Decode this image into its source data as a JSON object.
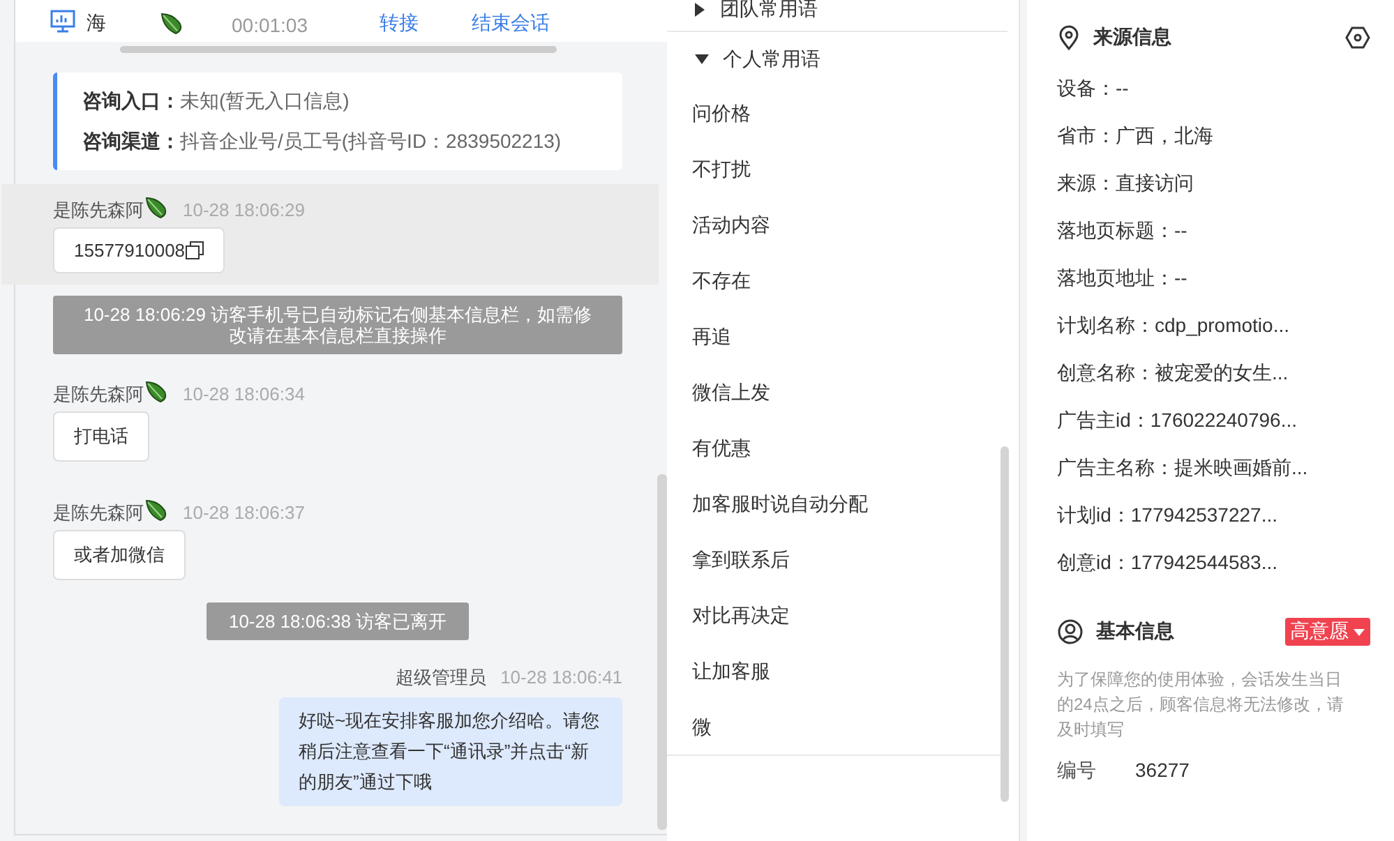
{
  "header": {
    "location": "海",
    "duration": "00:01:03",
    "actions": [
      {
        "label": "转接"
      },
      {
        "label": "结束会话"
      }
    ]
  },
  "consult_info": [
    {
      "label": "咨询入口：",
      "value": "未知(暂无入口信息)"
    },
    {
      "label": "咨询渠道：",
      "value": "抖音企业号/员工号(抖音号ID：2839502213)"
    }
  ],
  "messages": [
    {
      "kind": "visitor",
      "sender": "是陈先森阿",
      "time": "10-28 18:06:29",
      "text": "15577910008",
      "highlighted": true,
      "copyable": true
    },
    {
      "kind": "system",
      "text": "10-28 18:06:29 访客手机号已自动标记右侧基本信息栏，如需修改请在基本信息栏直接操作"
    },
    {
      "kind": "visitor",
      "sender": "是陈先森阿",
      "time": "10-28 18:06:34",
      "text": "打电话",
      "highlighted": false,
      "copyable": false
    },
    {
      "kind": "visitor",
      "sender": "是陈先森阿",
      "time": "10-28 18:06:37",
      "text": "或者加微信",
      "highlighted": false,
      "copyable": false
    },
    {
      "kind": "system",
      "text": "10-28 18:06:38 访客已离开"
    },
    {
      "kind": "agent",
      "sender": "超级管理员",
      "time": "10-28 18:06:41",
      "text": "好哒~现在安排客服加您介绍哈。请您稍后注意查看一下“通讯录”并点击“新的朋友”通过下哦",
      "highlighted": false,
      "copyable": false
    }
  ],
  "phrases": [
    {
      "title": "团队常用语",
      "expanded": false
    },
    {
      "title": "个人常用语",
      "expanded": true,
      "items": [
        "问价格",
        "不打扰",
        "活动内容",
        "不存在",
        "再追",
        "微信上发",
        "有优惠",
        "加客服时说自动分配",
        "拿到联系后",
        "对比再决定",
        "让加客服",
        "微"
      ]
    }
  ],
  "source_info": {
    "title": "来源信息",
    "fields": [
      "设备：--",
      "省市：广西，北海",
      "来源：直接访问",
      "落地页标题：--",
      "落地页地址：--",
      "计划名称：cdp_promotio...",
      "创意名称：被宠爱的女生...",
      "广告主id：176022240796...",
      "广告主名称：提米映画婚前...",
      "计划id：177942537227...",
      "创意id：177942544583..."
    ]
  },
  "basic_info": {
    "title": "基本信息",
    "tag": "高意愿",
    "note": "为了保障您的使用体验，会话发生当日的24点之后，顾客信息将无法修改，请及时填写",
    "fields": [
      {
        "label": "编号",
        "value": "36277"
      }
    ]
  }
}
